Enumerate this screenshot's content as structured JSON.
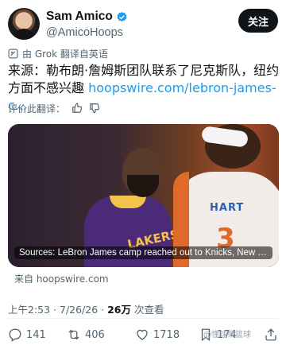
{
  "author": {
    "display_name": "Sam Amico",
    "handle": "@AmicoHoops",
    "verified": true
  },
  "follow_label": "关注",
  "translation_note": "由 Grok 翻译自英语",
  "tweet": {
    "text": "来源：勒布朗·詹姆斯团队联系了尼克斯队，纽约方面不感兴趣 ",
    "link_text": "hoopswire.com/lebron-james-c..."
  },
  "rate_translation_label": "评价此翻译：",
  "media": {
    "caption": "Sources: LeBron James camp reached out to Knicks, New Y...",
    "jersey_lakers": "LAKERS",
    "jersey_hart_name": "HART",
    "jersey_hart_number": "3"
  },
  "source_label": "来自 hoopswire.com",
  "meta": {
    "time_date": "上午2:53 · 7/26/26 · ",
    "views_count": "26万",
    "views_label": " 次查看"
  },
  "actions": {
    "replies": "141",
    "reposts": "406",
    "likes": "1718",
    "bookmarks": "174"
  },
  "watermark": "@懂球帝篮球"
}
